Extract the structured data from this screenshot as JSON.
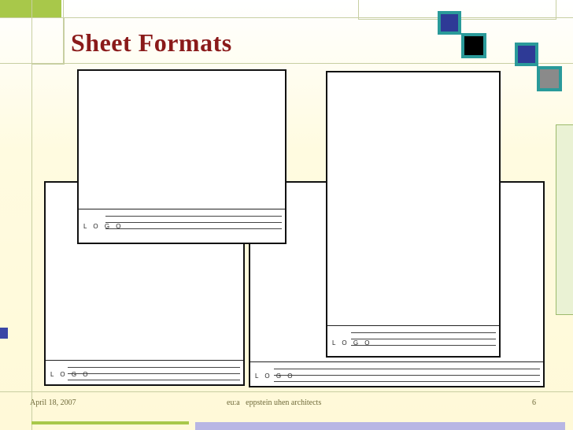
{
  "slide": {
    "title": "Sheet Formats",
    "footer_date": "April 18, 2007",
    "footer_center": "eu:a   eppstein uhen architects",
    "page_number": "6"
  },
  "title_block": {
    "logo_text": "L O G O"
  },
  "colors": {
    "accent_title": "#8a1a1a",
    "frame_green": "#c8cfa2",
    "square_blue": "#2e3a96",
    "square_teal_border": "#2a9a9a",
    "square_black": "#000000",
    "square_gray": "#8a8a8a"
  }
}
